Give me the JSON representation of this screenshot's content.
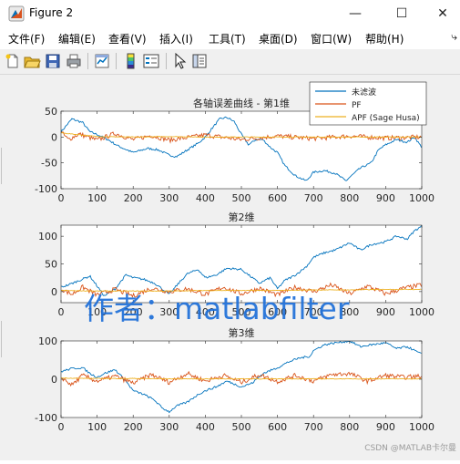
{
  "window": {
    "title": "Figure 2"
  },
  "menu": [
    "文件(F)",
    "编辑(E)",
    "查看(V)",
    "插入(I)",
    "工具(T)",
    "桌面(D)",
    "窗口(W)",
    "帮助(H)"
  ],
  "menu_more": "⤷",
  "toolbar": [
    "new-figure-icon",
    "open-file-icon",
    "save-icon",
    "print-icon",
    "link-plot-icon",
    "colorbar-icon",
    "legend-icon",
    "pointer-icon",
    "property-inspector-icon"
  ],
  "watermark": "作者：matlabfilter",
  "footer_credit": "CSDN @MATLAB卡尔曼",
  "colors": {
    "raw": "#0072bd",
    "pf": "#d95319",
    "apf": "#edb120"
  },
  "chart_data": [
    {
      "type": "line",
      "title": "各轴误差曲线 - 第1维",
      "xlim": [
        0,
        1000
      ],
      "ylim": [
        -100,
        50
      ],
      "xticks": [
        0,
        100,
        200,
        300,
        400,
        500,
        600,
        700,
        800,
        900,
        1000
      ],
      "yticks": [
        -100,
        -50,
        0,
        50
      ],
      "legend": {
        "position": "top-right",
        "entries": [
          "未滤波",
          "PF",
          "APF (Sage Husa)"
        ]
      },
      "series": [
        {
          "name": "未滤波",
          "x": [
            0,
            30,
            60,
            80,
            100,
            130,
            160,
            200,
            240,
            270,
            300,
            320,
            350,
            380,
            400,
            420,
            440,
            460,
            480,
            500,
            520,
            540,
            560,
            580,
            600,
            620,
            650,
            680,
            700,
            730,
            760,
            790,
            800,
            830,
            860,
            880,
            900,
            930,
            960,
            980,
            1000
          ],
          "y": [
            10,
            35,
            28,
            10,
            5,
            -5,
            -18,
            -30,
            -22,
            -25,
            -35,
            -38,
            -25,
            -12,
            0,
            18,
            35,
            38,
            30,
            5,
            -15,
            -5,
            -5,
            -20,
            -30,
            -55,
            -75,
            -85,
            -68,
            -65,
            -70,
            -85,
            -78,
            -60,
            -50,
            -25,
            -15,
            -5,
            -10,
            0,
            -20
          ]
        },
        {
          "name": "PF",
          "x": [
            0,
            20,
            50,
            100,
            150,
            200,
            250,
            300,
            400,
            500,
            600,
            700,
            800,
            900,
            1000
          ],
          "y": [
            10,
            -5,
            6,
            -6,
            7,
            -5,
            3,
            -6,
            4,
            -5,
            2,
            -3,
            2,
            -2,
            0
          ]
        },
        {
          "name": "APF (Sage Husa)",
          "x": [
            0,
            100,
            200,
            300,
            400,
            500,
            600,
            700,
            800,
            900,
            1000
          ],
          "y": [
            8,
            1,
            0,
            1,
            0,
            0,
            0,
            0,
            0,
            0,
            0
          ]
        }
      ]
    },
    {
      "type": "line",
      "title": "第2维",
      "xlim": [
        0,
        1000
      ],
      "ylim": [
        -20,
        120
      ],
      "xticks": [
        0,
        100,
        200,
        300,
        400,
        500,
        600,
        700,
        800,
        900,
        1000
      ],
      "yticks": [
        0,
        50,
        100
      ],
      "series": [
        {
          "name": "未滤波",
          "x": [
            0,
            20,
            50,
            80,
            100,
            120,
            150,
            180,
            200,
            230,
            260,
            280,
            300,
            330,
            350,
            380,
            400,
            430,
            460,
            500,
            520,
            550,
            580,
            600,
            620,
            650,
            680,
            700,
            730,
            760,
            800,
            830,
            860,
            900,
            930,
            960,
            980,
            1000
          ],
          "y": [
            8,
            12,
            20,
            28,
            10,
            -8,
            5,
            30,
            25,
            22,
            15,
            5,
            -5,
            18,
            32,
            40,
            25,
            30,
            42,
            40,
            30,
            15,
            25,
            5,
            20,
            30,
            45,
            62,
            70,
            75,
            88,
            75,
            85,
            90,
            100,
            95,
            110,
            118
          ]
        },
        {
          "name": "PF",
          "x": [
            0,
            30,
            60,
            100,
            150,
            200,
            250,
            300,
            350,
            400,
            450,
            500,
            550,
            600,
            650,
            700,
            750,
            800,
            850,
            900,
            950,
            1000
          ],
          "y": [
            5,
            -5,
            8,
            -6,
            4,
            -8,
            6,
            0,
            5,
            -5,
            8,
            -4,
            6,
            -6,
            8,
            0,
            12,
            -4,
            10,
            -4,
            6,
            12
          ]
        },
        {
          "name": "APF (Sage Husa)",
          "x": [
            0,
            100,
            200,
            300,
            400,
            500,
            600,
            700,
            800,
            900,
            1000
          ],
          "y": [
            2,
            1,
            1,
            1,
            2,
            2,
            2,
            3,
            3,
            4,
            4
          ]
        }
      ]
    },
    {
      "type": "line",
      "title": "第3维",
      "xlim": [
        0,
        1000
      ],
      "ylim": [
        -100,
        100
      ],
      "xticks": [
        0,
        100,
        200,
        300,
        400,
        500,
        600,
        700,
        800,
        900,
        1000
      ],
      "yticks": [
        -100,
        0,
        100
      ],
      "series": [
        {
          "name": "未滤波",
          "x": [
            0,
            30,
            60,
            80,
            100,
            120,
            150,
            180,
            200,
            230,
            260,
            280,
            300,
            320,
            350,
            380,
            400,
            430,
            460,
            500,
            530,
            560,
            600,
            630,
            660,
            690,
            700,
            730,
            760,
            800,
            830,
            860,
            900,
            930,
            960,
            1000
          ],
          "y": [
            20,
            28,
            30,
            15,
            5,
            15,
            25,
            -5,
            -30,
            -40,
            -55,
            -75,
            -85,
            -70,
            -60,
            -40,
            -30,
            -20,
            -5,
            -20,
            -10,
            15,
            30,
            45,
            55,
            60,
            75,
            90,
            95,
            100,
            85,
            90,
            95,
            80,
            85,
            65
          ]
        },
        {
          "name": "PF",
          "x": [
            0,
            30,
            60,
            100,
            150,
            200,
            250,
            300,
            350,
            400,
            450,
            500,
            550,
            600,
            650,
            700,
            750,
            800,
            850,
            900,
            950,
            1000
          ],
          "y": [
            5,
            -15,
            10,
            -5,
            8,
            -10,
            12,
            -8,
            15,
            -5,
            10,
            -8,
            12,
            -6,
            10,
            -5,
            12,
            15,
            -5,
            10,
            5,
            8
          ]
        },
        {
          "name": "APF (Sage Husa)",
          "x": [
            0,
            100,
            200,
            300,
            400,
            500,
            600,
            700,
            800,
            900,
            1000
          ],
          "y": [
            3,
            2,
            2,
            1,
            1,
            1,
            1,
            1,
            1,
            1,
            1
          ]
        }
      ]
    }
  ]
}
